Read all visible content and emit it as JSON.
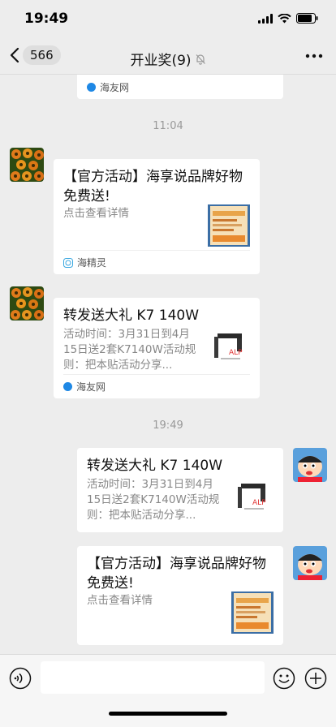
{
  "status": {
    "time": "19:49"
  },
  "nav": {
    "back_count": "566",
    "title": "开业奖(9)"
  },
  "messages": {
    "top_partial": {
      "source": "海友网"
    },
    "time1": "11:04",
    "m1": {
      "title": "【官方活动】海享说品牌好物免费送!",
      "desc": "点击查看详情",
      "source": "海精灵"
    },
    "m2": {
      "title": "转发送大礼 K7 140W",
      "desc": "活动时间：3月31日到4月15日送2套K7140W活动规则：把本贴活动分享...",
      "source": "海友网"
    },
    "time2": "19:49",
    "m3": {
      "title": "转发送大礼 K7 140W",
      "desc": "活动时间：3月31日到4月15日送2套K7140W活动规则：把本贴活动分享..."
    },
    "m4": {
      "title": "【官方活动】海享说品牌好物免费送!",
      "desc": "点击查看详情"
    }
  },
  "colors": {
    "background": "#ededed",
    "card": "#ffffff",
    "muted": "#888888",
    "source_blue": "#1e88e5"
  },
  "icons": [
    "back-chevron-icon",
    "mute-bell-icon",
    "more-icon",
    "voice-icon",
    "emoji-icon",
    "plus-icon"
  ]
}
